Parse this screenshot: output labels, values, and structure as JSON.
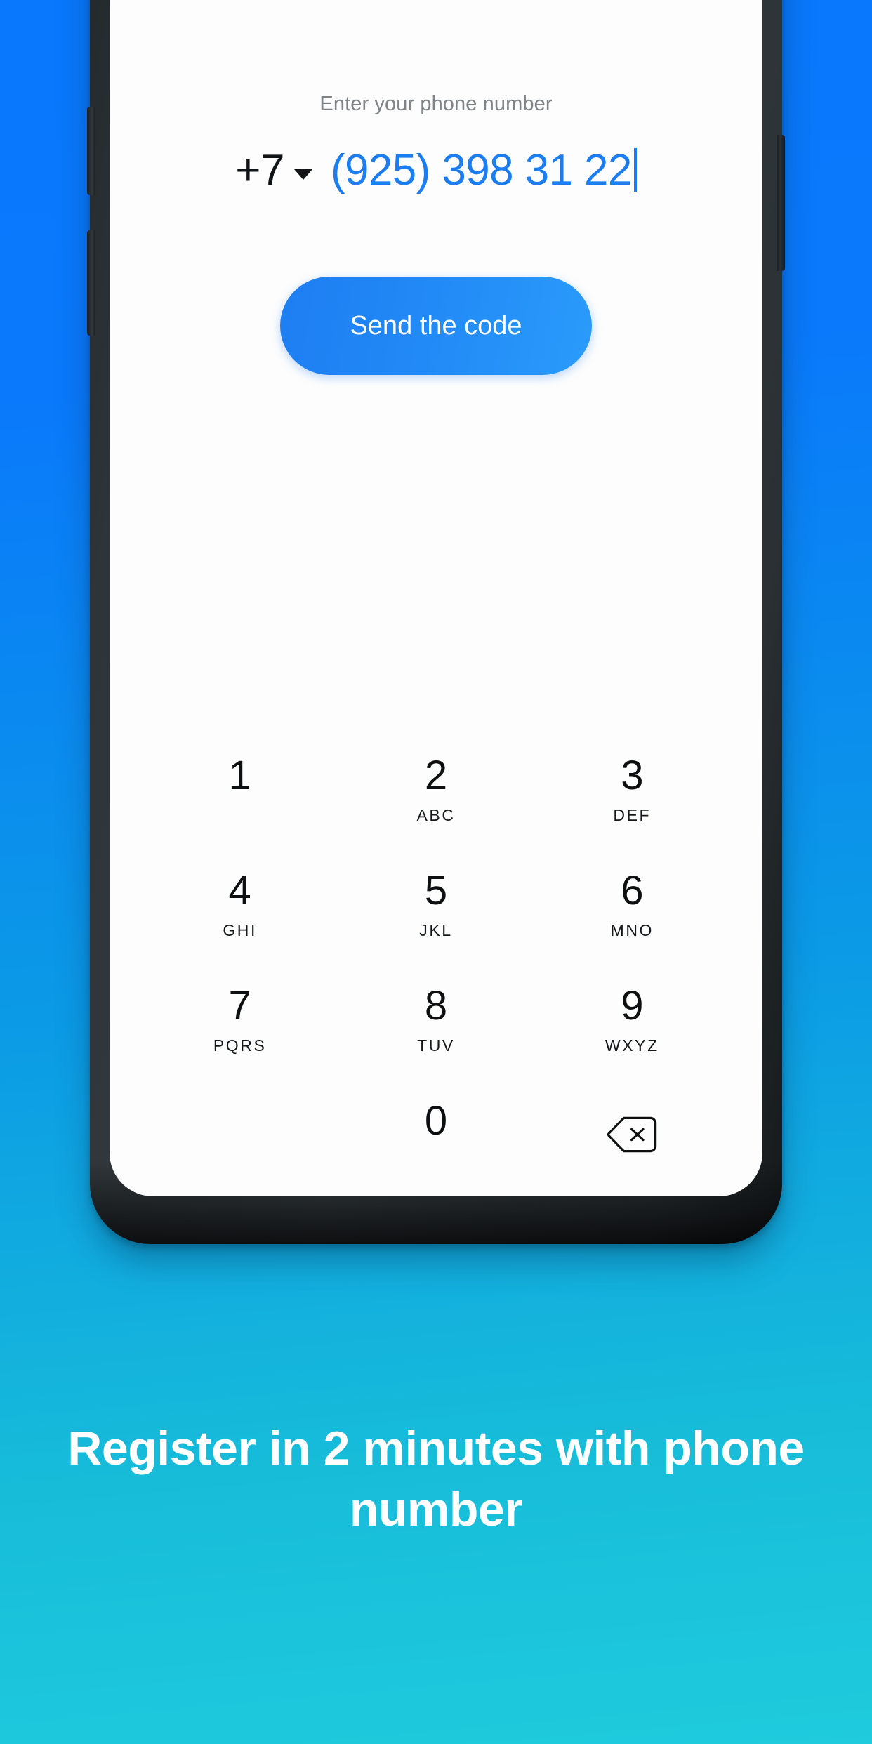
{
  "background": {
    "gradient_from": "#0a78fc",
    "gradient_to": "#1fcbdd"
  },
  "device": {
    "frame_color": "#2e3438",
    "buttons": {
      "volume_up": "volume-up",
      "volume_down": "volume-down",
      "power": "power"
    }
  },
  "screen": {
    "label": "Enter your phone number",
    "country_code": "+7",
    "country_code_icon": "chevron-down-icon",
    "phone_number": "(925) 398 31 22",
    "send_button": "Send the code",
    "accent_color": "#1c7df0",
    "button_gradient_from": "#1e7ef2",
    "button_gradient_to": "#2a9bfb"
  },
  "dialpad": {
    "rows": [
      [
        {
          "digit": "1",
          "letters": ""
        },
        {
          "digit": "2",
          "letters": "ABC"
        },
        {
          "digit": "3",
          "letters": "DEF"
        }
      ],
      [
        {
          "digit": "4",
          "letters": "GHI"
        },
        {
          "digit": "5",
          "letters": "JKL"
        },
        {
          "digit": "6",
          "letters": "MNO"
        }
      ],
      [
        {
          "digit": "7",
          "letters": "PQRS"
        },
        {
          "digit": "8",
          "letters": "TUV"
        },
        {
          "digit": "9",
          "letters": "WXYZ"
        }
      ]
    ],
    "bottom_row": {
      "star": "",
      "zero": "0",
      "backspace_icon": "backspace-icon"
    }
  },
  "headline": {
    "text": "Register in 2 minutes with phone number"
  }
}
